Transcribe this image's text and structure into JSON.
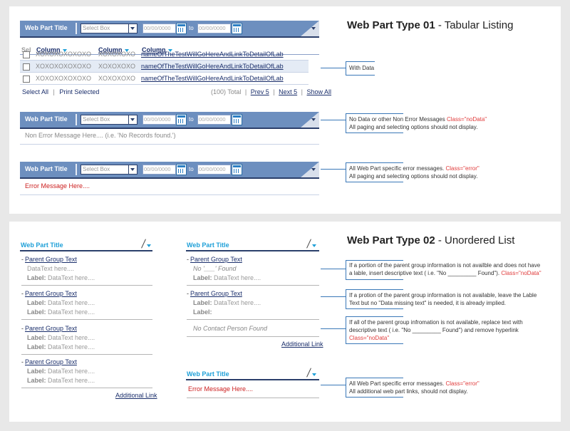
{
  "type01": {
    "heading_bold": "Web Part Type 01",
    "heading_rest": " - Tabular Listing",
    "bar": {
      "title": "Web Part Title",
      "select_placeholder": "Select Box",
      "date_placeholder": "00/00/0000",
      "to_label": "to"
    },
    "table": {
      "headers": [
        "Sel",
        "Column",
        "Column",
        "Column"
      ],
      "rows": [
        [
          "XOXOXOXOXOXO",
          "XOXOXOXO",
          "nameOfTheTestWillGoHereAndLinkToDetailOfLab"
        ],
        [
          "XOXOXOXOXOXO",
          "XOXOXOXO",
          "nameOfTheTestWillGoHereAndLinkToDetailOfLab"
        ],
        [
          "XOXOXOXOXOXO",
          "XOXOXOXO",
          "nameOfTheTestWillGoHereAndLinkToDetailOfLab"
        ]
      ]
    },
    "footer": {
      "select_all": "Select All",
      "divider": "|",
      "print_selected": "Print Selected",
      "total": "(100) Total",
      "prev": "Prev 5",
      "next": "Next 5",
      "show_all": "Show All"
    },
    "nodata_message": "Non Error Message Here.... (i.e. 'No Records found.')",
    "error_message": "Error Message Here....",
    "notes": {
      "with_data": "With Data",
      "nodata_line1": "No Data or other Non Error Messages",
      "nodata_class": "Class=\"noData\"",
      "nodata_line2": "All paging and selecting options should not display.",
      "error_line1": "All Web Part specific error messages.",
      "error_class": "Class=\"error\"",
      "error_line2": "All paging and selecting options should not display."
    }
  },
  "type02": {
    "heading_bold": "Web Part Type 02",
    "heading_rest": " - Unordered List",
    "title": "Web Part Title",
    "group_dash": "-",
    "group_text": "Parent Group Text",
    "datatext_here": "DataText here....",
    "label": "Label:",
    "datatext": "DataText here....",
    "no_found": "No '___' Found",
    "no_contact": "No Contact Person Found",
    "additional_link": "Additional Link",
    "error_message": "Error Message Here....",
    "notes": {
      "n1_line1": "If a portion of the parent group information is not availble and does not have",
      "n1_line2": "a lable, insert descriptive text  ( i.e. \"No _________ Found\").",
      "n1_class": "Class=\"noData\"",
      "n2_line1": "If a protion of the parent group information is not available, leave the Lable",
      "n2_line2": "Text but no \"Data missing text\" is needed, it is already implied.",
      "n3_line1": "If all of the parent group infromation is not available, replace text with",
      "n3_line2": "descriptive text ( i.e. \"No _________ Found\") and remove hyperlink",
      "n3_class": "Class=\"noData\"",
      "n4_line1": "All Web Part specific error messages.",
      "n4_class": "Class=\"error\"",
      "n4_line2": "All additional web part links, should not display."
    }
  }
}
